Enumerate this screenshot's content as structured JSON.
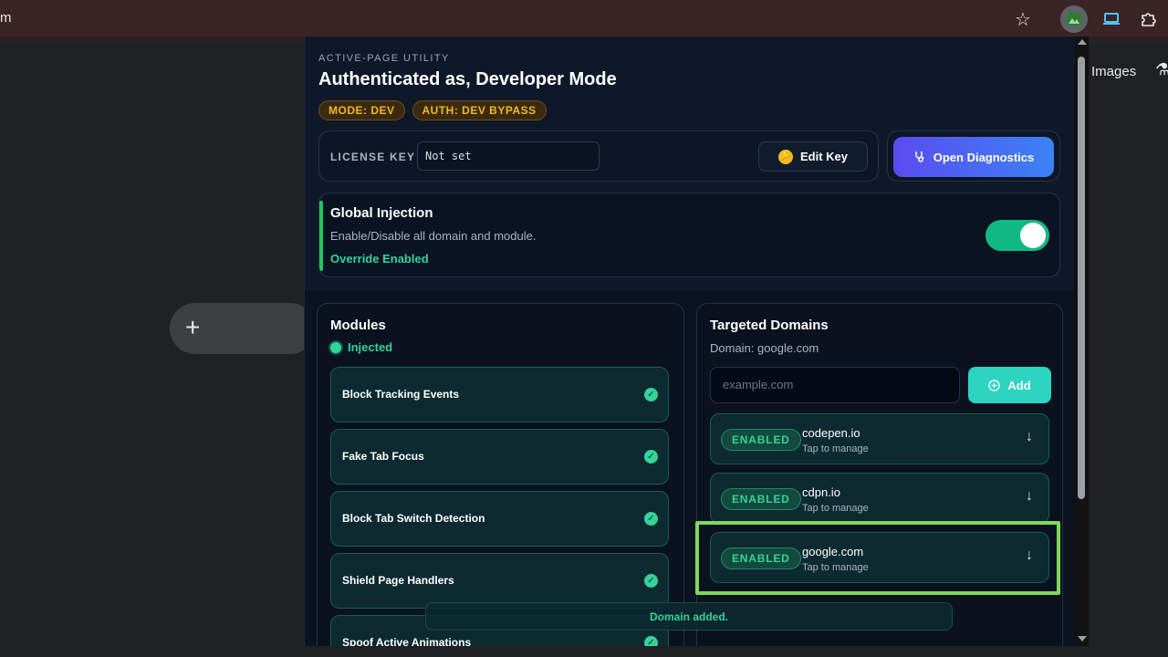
{
  "browser": {
    "url_fragment": "m",
    "star_icon": "star-icon",
    "puzzle_icon": "puzzle-icon"
  },
  "background_page": {
    "images_link": "Images",
    "plus_label": "+"
  },
  "popup": {
    "eyebrow": "ACTIVE-PAGE UTILITY",
    "title": "Authenticated as, Developer Mode",
    "badges": [
      "MODE: DEV",
      "AUTH: DEV BYPASS"
    ],
    "license": {
      "label": "LICENSE KEY",
      "value": "Not set",
      "edit_label": "Edit Key"
    },
    "diagnostics_label": "Open Diagnostics",
    "global_injection": {
      "title": "Global Injection",
      "description": "Enable/Disable all domain and module.",
      "status": "Override Enabled",
      "enabled": true
    },
    "modules": {
      "title": "Modules",
      "status": "Injected",
      "items": [
        "Block Tracking Events",
        "Fake Tab Focus",
        "Block Tab Switch Detection",
        "Shield Page Handlers",
        "Spoof Active Animations"
      ]
    },
    "domains": {
      "title": "Targeted Domains",
      "current": "Domain: google.com",
      "input_placeholder": "example.com",
      "add_label": "Add",
      "items": [
        {
          "status": "ENABLED",
          "name": "codepen.io",
          "hint": "Tap to manage"
        },
        {
          "status": "ENABLED",
          "name": "cdpn.io",
          "hint": "Tap to manage"
        },
        {
          "status": "ENABLED",
          "name": "google.com",
          "hint": "Tap to manage"
        }
      ]
    },
    "toast": "Domain added."
  },
  "colors": {
    "accent_green": "#34d399",
    "badge_amber": "#f5b921",
    "diagnostics_gradient": [
      "#5b4cf0",
      "#3b82f6"
    ],
    "highlight": "#7ed957"
  }
}
